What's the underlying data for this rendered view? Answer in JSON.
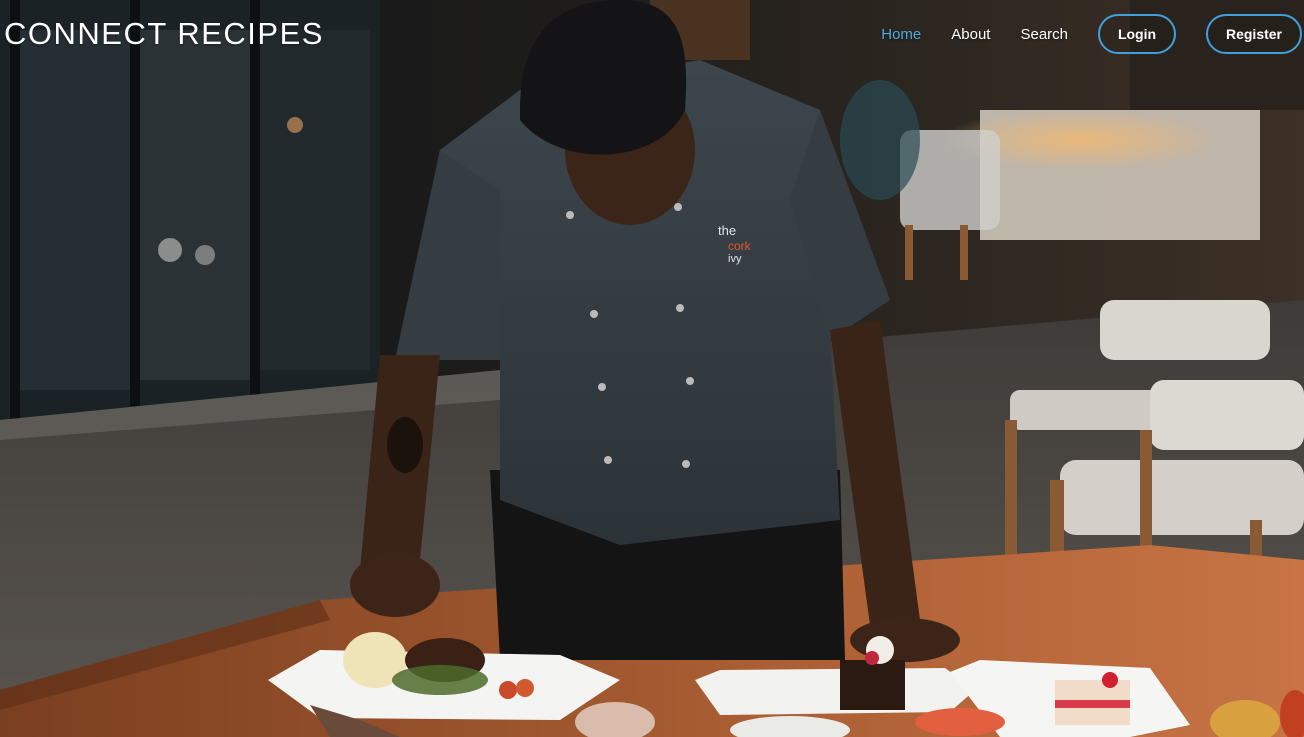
{
  "header": {
    "brand": "CONNECT RECIPES",
    "nav": [
      {
        "label": "Home",
        "active": true
      },
      {
        "label": "About",
        "active": false
      },
      {
        "label": "Search",
        "active": false
      }
    ],
    "login_label": "Login",
    "register_label": "Register"
  },
  "hero": {
    "image": "chef-plating-dishes-photo",
    "apron_logo": "the cork ivy"
  },
  "colors": {
    "accent": "#3fa0dc",
    "active_link": "#4fa9e0",
    "text": "#ffffff"
  }
}
